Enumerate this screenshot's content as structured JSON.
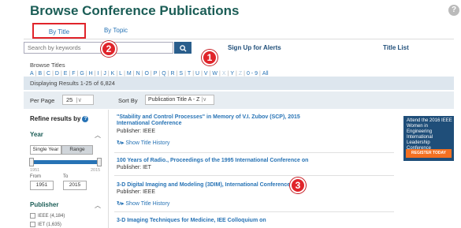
{
  "header": {
    "title": "Browse Conference Publications",
    "help_icon": "help-icon"
  },
  "tabs": [
    {
      "label": "By Title",
      "selected": true
    },
    {
      "label": "By Topic",
      "selected": false
    }
  ],
  "search": {
    "placeholder": "Search by keywords",
    "icon": "search-icon"
  },
  "links": {
    "alerts": "Sign Up for Alerts",
    "title_list": "Title List"
  },
  "browse": {
    "label": "Browse Titles",
    "letters": [
      "A",
      "B",
      "C",
      "D",
      "E",
      "F",
      "G",
      "H",
      "I",
      "J",
      "K",
      "L",
      "M",
      "N",
      "O",
      "P",
      "Q",
      "R",
      "S",
      "T",
      "U",
      "V",
      "W",
      "X",
      "Y",
      "Z",
      "0 - 9",
      "All"
    ],
    "dimmed": [
      "X",
      "Z"
    ]
  },
  "results": {
    "text": "Displaying Results 1-25 of 6,824"
  },
  "controls": {
    "per_page_label": "Per Page",
    "per_page_value": "25",
    "sort_label": "Sort By",
    "sort_value": "Publication Title A - Z"
  },
  "sidebar": {
    "refine_title": "Refine results by",
    "year_label": "Year",
    "single_year": "Single Year",
    "range": "Range",
    "slider_min": "1951",
    "slider_max": "2015",
    "from_label": "From",
    "to_label": "To",
    "from_value": "1951",
    "to_value": "2015",
    "publisher_label": "Publisher",
    "publishers": [
      {
        "label": "IEEE (4,184)"
      },
      {
        "label": "IET (1,635)"
      }
    ]
  },
  "list": [
    {
      "title_line1": "\"Stability and Control Processes\" in Memory of V.I. Zubov (SCP), 2015",
      "title_line2": "International Conference",
      "publisher": "Publisher: IEEE",
      "history": "Show Title History"
    },
    {
      "title_line1": "100 Years of Radio., Proceedings of the 1995 International Conference on",
      "title_line2": "",
      "publisher": "Publisher: IET",
      "history": ""
    },
    {
      "title_line1": "3-D Digital Imaging and Modeling (3DIM), International Conference on",
      "title_line2": "",
      "publisher": "Publisher: IEEE",
      "history": "Show Title History"
    },
    {
      "title_line1": "3-D Imaging Techniques for Medicine, IEE Colloquium on",
      "title_line2": "",
      "publisher": "",
      "history": ""
    }
  ],
  "ad": {
    "text": "Attend the 2016 IEEE Women in Engineering International Leadership Conference",
    "button": "REGISTER TODAY"
  },
  "badges": [
    "1",
    "2",
    "3"
  ],
  "colors": {
    "title_green": "#1b5d56",
    "link_blue": "#2773b5",
    "badge_red": "#e0242a",
    "ad_navy": "#1f4e79",
    "ad_orange": "#f37021"
  }
}
